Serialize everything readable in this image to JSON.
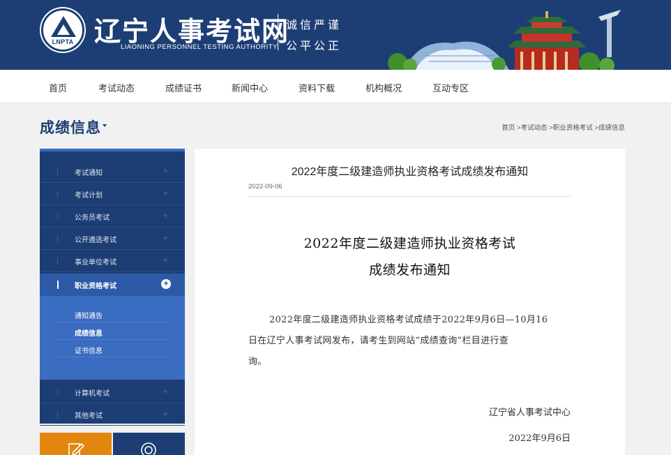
{
  "header": {
    "logo_abbr": "LNPTA",
    "site_title": "辽宁人事考试网",
    "site_subtitle": "LIAONING PERSONNEL TESTING AUTHORITY",
    "slogan_line1": "诚信严谨",
    "slogan_line2": "公平公正"
  },
  "nav": {
    "items": [
      {
        "label": "首页"
      },
      {
        "label": "考试动态"
      },
      {
        "label": "成绩证书"
      },
      {
        "label": "新闻中心"
      },
      {
        "label": "资料下载"
      },
      {
        "label": "机构概况"
      },
      {
        "label": "互动专区"
      }
    ]
  },
  "section": {
    "title": "成绩信息",
    "breadcrumb": [
      "首页",
      ">考试动态",
      ">职业资格考试",
      ">成绩信息"
    ]
  },
  "sidebar": {
    "items": [
      {
        "label": "考试通知",
        "icon": "plus-icon"
      },
      {
        "label": "考试计划",
        "icon": "plus-icon"
      },
      {
        "label": "公务员考试",
        "icon": "plus-icon"
      },
      {
        "label": "公开遴选考试",
        "icon": "plus-icon"
      },
      {
        "label": "事业单位考试",
        "icon": "plus-icon"
      },
      {
        "label": "职业资格考试",
        "icon": "plus-circle-icon",
        "active": true
      },
      {
        "label": "计算机考试",
        "icon": "plus-icon"
      },
      {
        "label": "其他考试",
        "icon": "plus-icon"
      }
    ],
    "submenu": [
      {
        "label": "通知通告"
      },
      {
        "label": "成绩信息",
        "current": true
      },
      {
        "label": "证书信息"
      }
    ]
  },
  "shortcuts": [
    {
      "icon": "pencil-icon",
      "color": "#e3860f"
    },
    {
      "icon": "search-icon",
      "color": "#1d3e74"
    }
  ],
  "article": {
    "title": "2022年度二级建造师执业资格考试成绩发布通知",
    "date": "2022-09-06",
    "heading_line1": "2022年度二级建造师执业资格考试",
    "heading_line2": "成绩发布通知",
    "body_line1": "2022年度二级建造师执业资格考试成绩于2022年9月6日—10月16",
    "body_line2": "日在辽宁人事考试网发布，请考生到网站“成绩查询”栏目进行查",
    "body_line3": "询。",
    "signature": "辽宁省人事考试中心",
    "signature_date": "2022年9月6日"
  },
  "colors": {
    "brand_blue": "#1d3e74",
    "accent_blue": "#3a6cc1",
    "active_blue": "#2d5aa6",
    "orange": "#e3860f"
  }
}
